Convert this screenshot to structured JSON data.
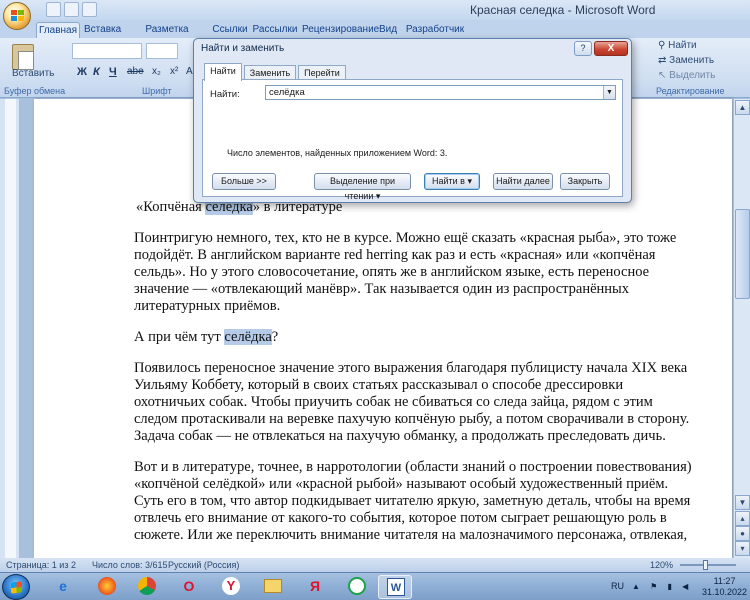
{
  "window": {
    "title": "Красная селедка - Microsoft Word"
  },
  "ribbon": {
    "tabs": [
      "Главная",
      "Вставка",
      "Разметка страницы",
      "Ссылки",
      "Рассылки",
      "Рецензирование",
      "Вид",
      "Разработчик"
    ],
    "active_tab": "Главная",
    "paste_label": "Вставить",
    "groups": {
      "clipboard": "Буфер обмена",
      "font": "Шрифт",
      "editing": "Редактирование"
    },
    "format_buttons": [
      "Ж",
      "К",
      "Ч",
      "abe",
      "x₂",
      "x²",
      "Aa"
    ],
    "editing": {
      "find": "Найти",
      "replace": "Заменить",
      "select": "Выделить"
    }
  },
  "dialog": {
    "title": "Найти и заменить",
    "help": "?",
    "close": "X",
    "tabs": [
      "Найти",
      "Заменить",
      "Перейти"
    ],
    "active_tab": "Найти",
    "find_label": "Найти:",
    "find_value": "селёдка",
    "result_message": "Число элементов, найденных приложением Word: 3.",
    "buttons": {
      "more": "Больше >>",
      "reading_highlight": "Выделение при чтении ▾",
      "find_in": "Найти в ▾",
      "find_next": "Найти далее",
      "close": "Закрыть"
    }
  },
  "document": {
    "heading": {
      "before": "«Копчёная ",
      "highlight": "селёдка",
      "after": "» в литературе"
    },
    "p1": "Поинтригую немного, тех, кто не в курсе. Можно ещё сказать «красная рыба», это тоже подойдёт. В английском варианте red herring как раз и есть «красная» или «копчёная сельдь». Но у этого словосочетание, опять же в английском языке, есть переносное значение — «отвлекающий манёвр». Так называется один из распространённых литературных приёмов.",
    "sub": {
      "before": "А при чём  тут ",
      "highlight": "селёдка",
      "after": "?"
    },
    "p2": "Появилось переносное значение этого выражения благодаря публицисту начала XIX века Уильяму Коббету, который в своих статьях рассказывал о способе дрессировки охотничьих собак. Чтобы приучить собак не сбиваться со следа зайца, рядом с этим следом протаскивали на веревке пахучую копчёную рыбу, а потом сворачивали в сторону. Задача собак — не отвлекаться на пахучую обманку, а продолжать преследовать дичь.",
    "p3": "Вот и в литературе, точнее, в нарротологии (области знаний о построении повествования) «копчёной селёдкой» или «красной рыбой» называют особый художественный приём. Суть его в том, что автор подкидывает читателю яркую, заметную деталь, чтобы на время отвлечь его внимание от какого-то события, которое потом сыграет решающую роль в сюжете. Или же переключить внимание читателя на малозначимого персонажа, отвлекая,"
  },
  "statusbar": {
    "page": "Страница: 1 из 2",
    "words": "Число слов: 3/615",
    "language": "Русский (Россия)",
    "zoom": "120%"
  },
  "taskbar": {
    "apps": [
      "ie-icon",
      "firefox-icon",
      "chrome-icon",
      "opera-icon",
      "yandex-browser-icon",
      "folder-icon",
      "yandex-icon",
      "notification-app-icon",
      "word-icon"
    ],
    "language": "RU",
    "time": "11:27",
    "date": "31.10.2022"
  },
  "colors": {
    "ribbon": "#cfdef1",
    "highlight": "#b5cbe8",
    "dialog_close": "#c8432f"
  }
}
